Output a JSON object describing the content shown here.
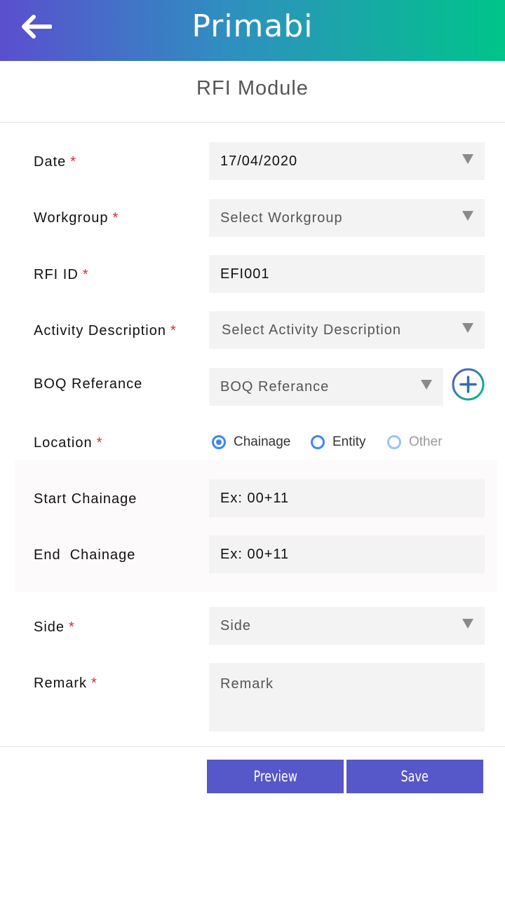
{
  "header": {
    "logo_text": "Primabi",
    "back_icon": "arrow-left-icon"
  },
  "page": {
    "title": "RFI Module"
  },
  "form": {
    "date": {
      "label": "Date",
      "required": "*",
      "value": "17/04/2020"
    },
    "workgroup": {
      "label": "Workgroup",
      "required": "*",
      "placeholder": "Select Workgroup"
    },
    "rfi_id": {
      "label": "RFI ID",
      "required": "*",
      "value": "EFI001"
    },
    "activity": {
      "label": "Activity Description",
      "required": "*",
      "placeholder": "Select Activity Description"
    },
    "boq": {
      "label": "BOQ Referance",
      "placeholder": "BOQ Referance",
      "add_icon": "plus-circle-icon"
    },
    "location": {
      "label": "Location",
      "required": "*",
      "options": [
        "Chainage",
        "Entity",
        "Other"
      ],
      "selected": "Chainage"
    },
    "start_chainage": {
      "label": "Start Chainage",
      "placeholder": "Ex: 00+11"
    },
    "end_chainage": {
      "label": "End  Chainage",
      "placeholder": "Ex: 00+11"
    },
    "side": {
      "label": "Side",
      "required": "*",
      "placeholder": "Side"
    },
    "remark": {
      "label": "Remark",
      "required": "*",
      "placeholder": "Remark"
    }
  },
  "actions": {
    "preview_label": "Preview",
    "save_label": "Save"
  },
  "colors": {
    "accent": "#5657c8",
    "radio": "#3a86ff",
    "required": "#e0272b",
    "gradient_start": "#5a4fcf",
    "gradient_end": "#00c48a"
  }
}
